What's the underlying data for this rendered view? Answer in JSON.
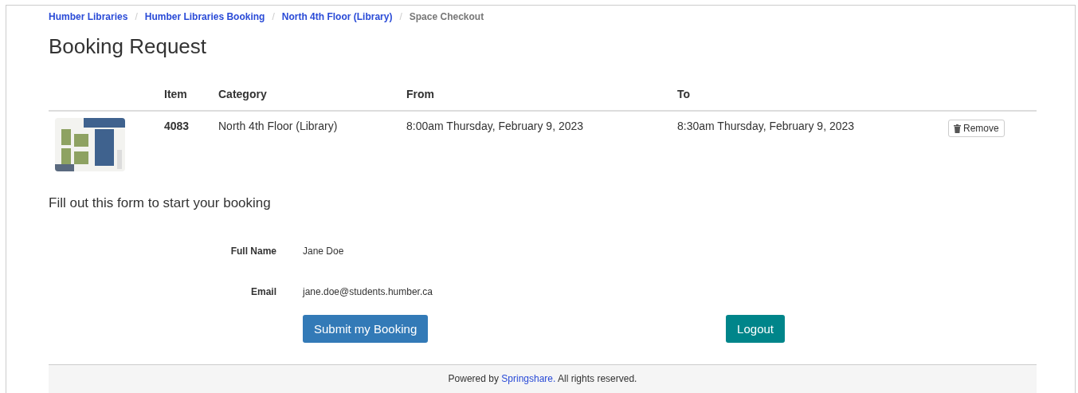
{
  "breadcrumbs": [
    {
      "label": "Humber Libraries",
      "kind": "link"
    },
    {
      "label": "Humber Libraries Booking",
      "kind": "link"
    },
    {
      "label": "North 4th Floor (Library)",
      "kind": "link"
    },
    {
      "label": "Space Checkout",
      "kind": "current"
    }
  ],
  "separator": "/",
  "title": "Booking Request",
  "table": {
    "columns": [
      "Item",
      "Category",
      "From",
      "To"
    ],
    "rows": [
      {
        "item": "4083",
        "category": "North 4th Floor (Library)",
        "from": "8:00am Thursday, February 9, 2023",
        "to": "8:30am Thursday, February 9, 2023",
        "action": "Remove"
      }
    ]
  },
  "form": {
    "prompt": "Fill out this form to start your booking",
    "fields": [
      {
        "label": "Full Name",
        "value": "Jane Doe"
      },
      {
        "label": "Email",
        "value": "jane.doe@students.humber.ca"
      }
    ],
    "buttons": [
      {
        "label": "Submit my Booking",
        "kind": "primary"
      },
      {
        "label": "Logout",
        "kind": "teal"
      }
    ]
  },
  "footer": {
    "prefix": "Powered by",
    "link": "Springshare.",
    "suffix": "All rights reserved."
  }
}
